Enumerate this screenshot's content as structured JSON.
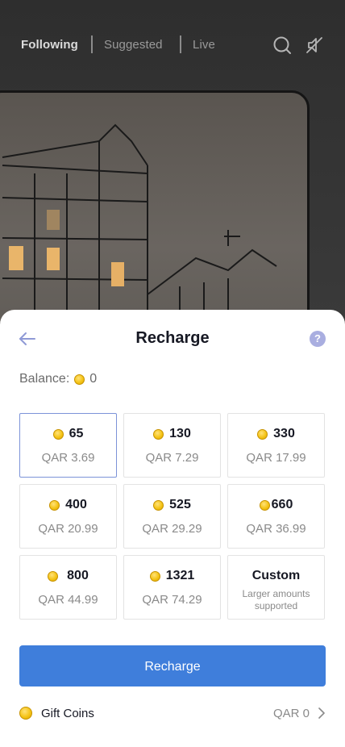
{
  "nav": {
    "tabs": [
      {
        "label": "Following",
        "active": true
      },
      {
        "label": "Suggested",
        "active": false
      },
      {
        "label": "Live",
        "active": false
      }
    ],
    "icons": [
      "search-icon",
      "mute-icon"
    ]
  },
  "sheet": {
    "title": "Recharge",
    "back_icon": "arrow-left-icon",
    "help_icon": "question-icon",
    "help_glyph": "?",
    "balance_label": "Balance:",
    "balance_value": "0",
    "packages": [
      {
        "coins": "65",
        "price": "QAR 3.69",
        "selected": true
      },
      {
        "coins": "130",
        "price": "QAR 7.29",
        "selected": false
      },
      {
        "coins": "330",
        "price": "QAR 17.99",
        "selected": false
      },
      {
        "coins": "400",
        "price": "QAR 20.99",
        "selected": false
      },
      {
        "coins": "525",
        "price": "QAR 29.29",
        "selected": false
      },
      {
        "coins": "660",
        "price": "QAR 36.99",
        "selected": false
      },
      {
        "coins": "800",
        "price": "QAR 44.99",
        "selected": false
      },
      {
        "coins": "1321",
        "price": "QAR 74.29",
        "selected": false
      }
    ],
    "custom": {
      "label": "Custom",
      "sub": "Larger amounts supported"
    },
    "recharge_button": "Recharge",
    "gift_coins": {
      "label": "Gift Coins",
      "value": "QAR 0"
    }
  },
  "colors": {
    "accent": "#3f7edb",
    "selected_border": "#7c93d8",
    "coin_gold": "#f5c417"
  }
}
